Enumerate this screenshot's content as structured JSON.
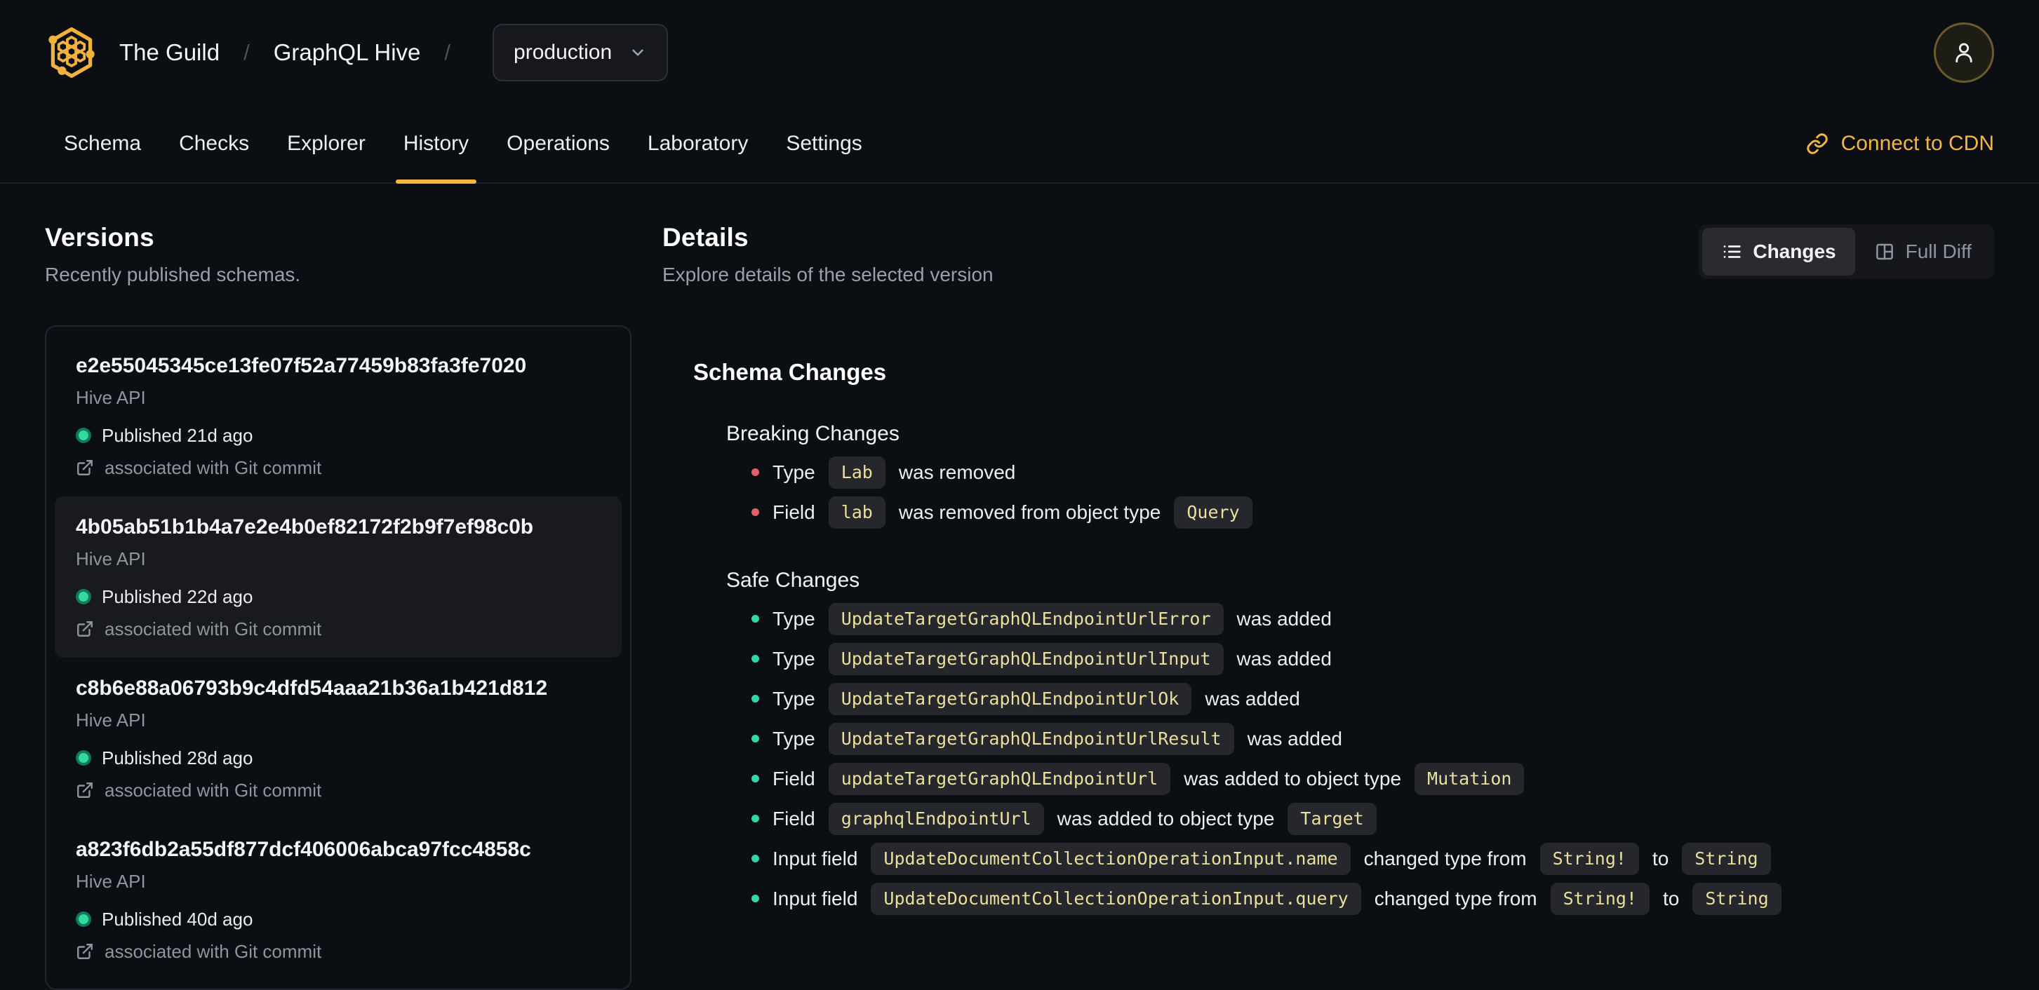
{
  "header": {
    "org": "The Guild",
    "project": "GraphQL Hive",
    "separator": "/",
    "target_selector": {
      "value": "production"
    }
  },
  "tabs": {
    "items": [
      {
        "label": "Schema",
        "active": false
      },
      {
        "label": "Checks",
        "active": false
      },
      {
        "label": "Explorer",
        "active": false
      },
      {
        "label": "History",
        "active": true
      },
      {
        "label": "Operations",
        "active": false
      },
      {
        "label": "Laboratory",
        "active": false
      },
      {
        "label": "Settings",
        "active": false
      }
    ],
    "connect_cdn_label": "Connect to CDN"
  },
  "versions": {
    "title": "Versions",
    "subtitle": "Recently published schemas.",
    "items": [
      {
        "hash": "e2e55045345ce13fe07f52a77459b83fa3fe7020",
        "service": "Hive API",
        "status": "Published 21d ago",
        "git": "associated with Git commit",
        "selected": false
      },
      {
        "hash": "4b05ab51b1b4a7e2e4b0ef82172f2b9f7ef98c0b",
        "service": "Hive API",
        "status": "Published 22d ago",
        "git": "associated with Git commit",
        "selected": true
      },
      {
        "hash": "c8b6e88a06793b9c4dfd54aaa21b36a1b421d812",
        "service": "Hive API",
        "status": "Published 28d ago",
        "git": "associated with Git commit",
        "selected": false
      },
      {
        "hash": "a823f6db2a55df877dcf406006abca97fcc4858c",
        "service": "Hive API",
        "status": "Published 40d ago",
        "git": "associated with Git commit",
        "selected": false
      }
    ]
  },
  "details": {
    "title": "Details",
    "subtitle": "Explore details of the selected version",
    "view_toggle": {
      "changes": "Changes",
      "full_diff": "Full Diff"
    },
    "schema_changes": {
      "title": "Schema Changes",
      "breaking": {
        "title": "Breaking Changes",
        "items": [
          {
            "parts": [
              {
                "text": "Type",
                "code": false
              },
              {
                "text": "Lab",
                "code": true
              },
              {
                "text": "was removed",
                "code": false
              }
            ]
          },
          {
            "parts": [
              {
                "text": "Field",
                "code": false
              },
              {
                "text": "lab",
                "code": true
              },
              {
                "text": "was removed from object type",
                "code": false
              },
              {
                "text": "Query",
                "code": true
              }
            ]
          }
        ]
      },
      "safe": {
        "title": "Safe Changes",
        "items": [
          {
            "parts": [
              {
                "text": "Type",
                "code": false
              },
              {
                "text": "UpdateTargetGraphQLEndpointUrlError",
                "code": true
              },
              {
                "text": "was added",
                "code": false
              }
            ]
          },
          {
            "parts": [
              {
                "text": "Type",
                "code": false
              },
              {
                "text": "UpdateTargetGraphQLEndpointUrlInput",
                "code": true
              },
              {
                "text": "was added",
                "code": false
              }
            ]
          },
          {
            "parts": [
              {
                "text": "Type",
                "code": false
              },
              {
                "text": "UpdateTargetGraphQLEndpointUrlOk",
                "code": true
              },
              {
                "text": "was added",
                "code": false
              }
            ]
          },
          {
            "parts": [
              {
                "text": "Type",
                "code": false
              },
              {
                "text": "UpdateTargetGraphQLEndpointUrlResult",
                "code": true
              },
              {
                "text": "was added",
                "code": false
              }
            ]
          },
          {
            "parts": [
              {
                "text": "Field",
                "code": false
              },
              {
                "text": "updateTargetGraphQLEndpointUrl",
                "code": true
              },
              {
                "text": "was added to object type",
                "code": false
              },
              {
                "text": "Mutation",
                "code": true
              }
            ]
          },
          {
            "parts": [
              {
                "text": "Field",
                "code": false
              },
              {
                "text": "graphqlEndpointUrl",
                "code": true
              },
              {
                "text": "was added to object type",
                "code": false
              },
              {
                "text": "Target",
                "code": true
              }
            ]
          },
          {
            "parts": [
              {
                "text": "Input field",
                "code": false
              },
              {
                "text": "UpdateDocumentCollectionOperationInput.name",
                "code": true
              },
              {
                "text": "changed type from",
                "code": false
              },
              {
                "text": "String!",
                "code": true
              },
              {
                "text": "to",
                "code": false
              },
              {
                "text": "String",
                "code": true
              }
            ]
          },
          {
            "parts": [
              {
                "text": "Input field",
                "code": false
              },
              {
                "text": "UpdateDocumentCollectionOperationInput.query",
                "code": true
              },
              {
                "text": "changed type from",
                "code": false
              },
              {
                "text": "String!",
                "code": true
              },
              {
                "text": "to",
                "code": false
              },
              {
                "text": "String",
                "code": true
              }
            ]
          }
        ]
      }
    }
  },
  "colors": {
    "background": "#0b0e13",
    "accent_amber": "#f4b740",
    "breaking_bullet": "#e25f6b",
    "safe_bullet": "#33d6a6",
    "published_dot": "#34d9a0",
    "code_chip_bg": "#26272c",
    "code_chip_text": "#eadf9b",
    "muted_text": "#98a0aa",
    "selected_card_bg": "#191a1e"
  }
}
